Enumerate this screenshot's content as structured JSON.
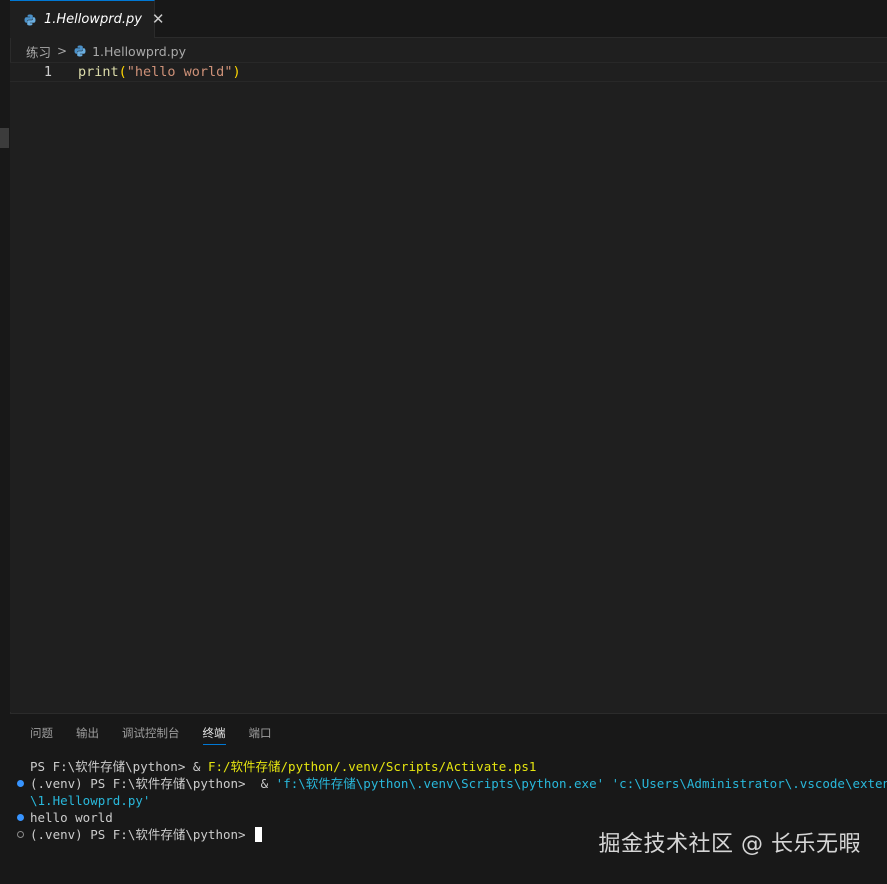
{
  "tab": {
    "label": "1.Hellowprd.py",
    "close": "✕"
  },
  "breadcrumb": {
    "folder": "练习",
    "separator": ">",
    "file": "1.Hellowprd.py"
  },
  "editor": {
    "line_number": "1",
    "code": {
      "fn": "print",
      "open": "(",
      "str": "\"hello world\"",
      "close": ")"
    }
  },
  "panel": {
    "tabs": [
      "问题",
      "输出",
      "调试控制台",
      "终端",
      "端口"
    ],
    "active_tab": "终端"
  },
  "terminal": {
    "line1": {
      "prompt": "PS F:\\软件存储\\python> & ",
      "path": "F:/软件存储/python/.venv/Scripts/Activate.ps1"
    },
    "line2": {
      "prompt": "(.venv) PS F:\\软件存储\\python>  & ",
      "cmd": "'f:\\软件存储\\python\\.venv\\Scripts\\python.exe' 'c:\\Users\\Administrator\\.vscode\\extensions\\"
    },
    "line3": {
      "cmd": "\\1.Hellowprd.py'"
    },
    "line4": {
      "text": "hello world"
    },
    "line5": {
      "prompt": "(.venv) PS F:\\软件存储\\python> "
    }
  },
  "watermark": "掘金技术社区 @ 长乐无暇",
  "colors": {
    "accent": "#0078d4",
    "python_icon": "#4a90c8",
    "fn": "#dcdcaa",
    "paren": "#ffd700",
    "string": "#ce9178",
    "terminal_yellow": "#e5e510",
    "terminal_cyan": "#29b8db"
  }
}
